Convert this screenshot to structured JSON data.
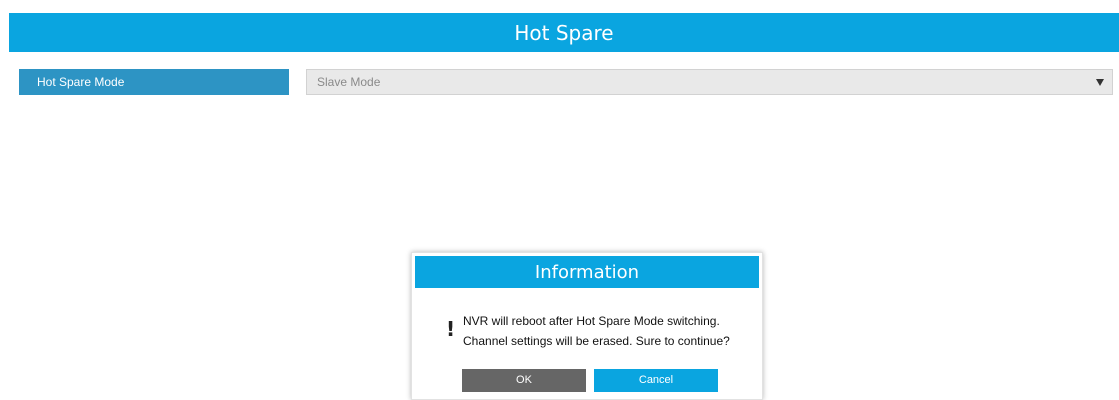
{
  "header": {
    "title": "Hot Spare"
  },
  "hot_spare_mode": {
    "label": "Hot Spare Mode",
    "selected_value": "Slave Mode"
  },
  "dialog": {
    "title": "Information",
    "icon": "!",
    "message_line_1": "NVR will reboot after Hot Spare Mode switching.",
    "message_line_2": "Channel settings will be erased. Sure to continue?",
    "ok_label": "OK",
    "cancel_label": "Cancel"
  },
  "colors": {
    "accent": "#0aa5e0",
    "label_bg": "#2d94c4",
    "ok_button": "#666666"
  }
}
